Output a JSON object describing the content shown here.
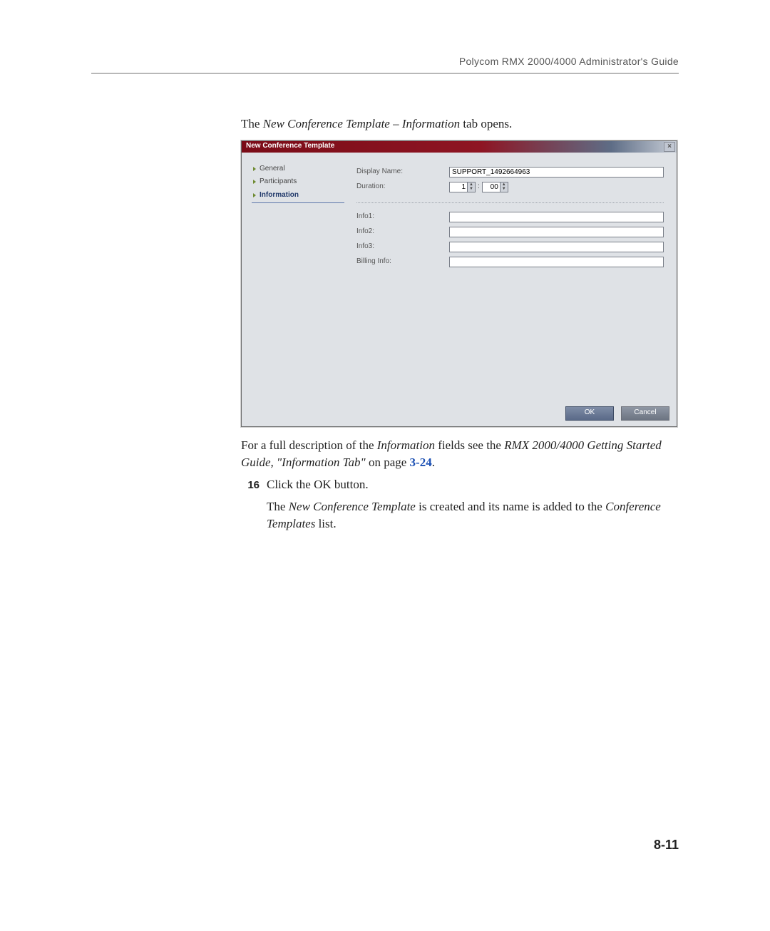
{
  "header": {
    "running": "Polycom RMX 2000/4000 Administrator's Guide"
  },
  "intro": {
    "prefix": "The ",
    "italic": "New Conference Template – Information",
    "suffix": " tab opens."
  },
  "dialog": {
    "title": "New Conference Template",
    "close_label": "×",
    "sidenav": {
      "general": "General",
      "participants": "Participants",
      "information": "Information"
    },
    "labels": {
      "display_name": "Display Name:",
      "duration": "Duration:",
      "info1": "Info1:",
      "info2": "Info2:",
      "info3": "Info3:",
      "billing": "Billing Info:"
    },
    "values": {
      "display_name": "SUPPORT_1492664963",
      "duration_h": "1",
      "duration_m": "00",
      "info1": "",
      "info2": "",
      "info3": "",
      "billing": ""
    },
    "buttons": {
      "ok": "OK",
      "cancel": "Cancel"
    }
  },
  "after": {
    "p1_a": "For a full description of the ",
    "p1_i1": "Information",
    "p1_b": " fields see the ",
    "p1_i2": "RMX 2000/4000 Getting Started Guide, \"Information Tab\"",
    "p1_c": " on page ",
    "p1_link": "3-24",
    "p1_d": "."
  },
  "step": {
    "num": "16",
    "line1": "Click the OK button.",
    "line2_a": "The ",
    "line2_i1": "New Conference Template",
    "line2_b": " is created and its name is added to the ",
    "line2_i2": "Conference Templates",
    "line2_c": " list."
  },
  "pagenum": "8-11"
}
